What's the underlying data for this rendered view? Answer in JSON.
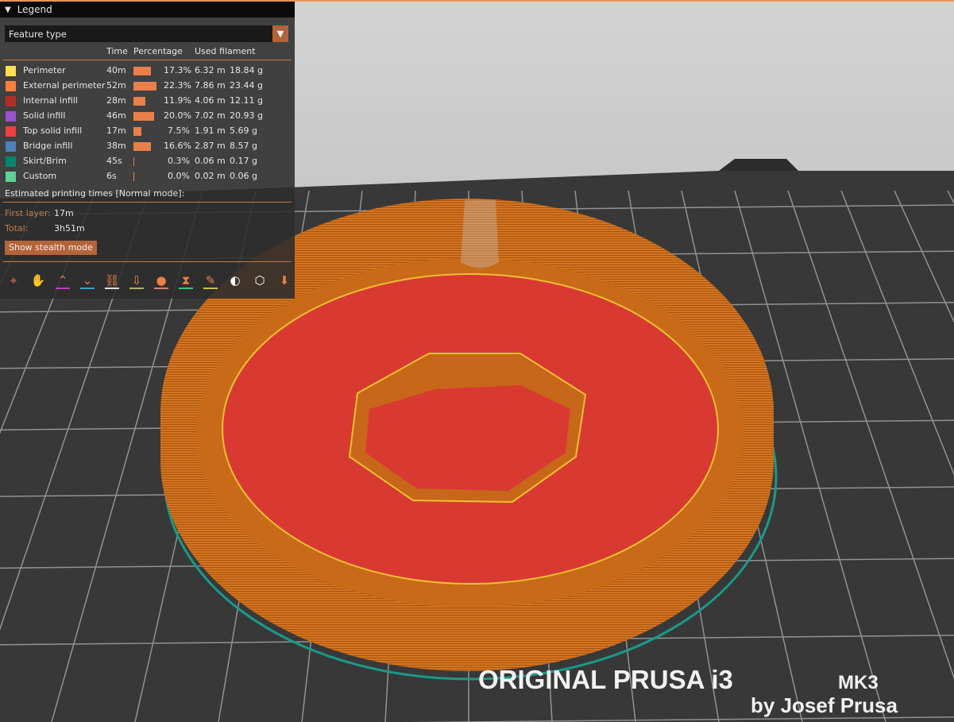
{
  "legend": {
    "title": "Legend",
    "view_type": "Feature type",
    "columns": {
      "time": "Time",
      "percentage": "Percentage",
      "used_filament": "Used filament"
    },
    "rows": [
      {
        "label": "Perimeter",
        "color": "#ffe14d",
        "time": "40m",
        "percent": 17.3,
        "percent_label": "17.3%",
        "length": "6.32 m",
        "weight": "18.84 g"
      },
      {
        "label": "External perimeter",
        "color": "#ff7d38",
        "time": "52m",
        "percent": 22.3,
        "percent_label": "22.3%",
        "length": "7.86 m",
        "weight": "23.44 g"
      },
      {
        "label": "Internal infill",
        "color": "#b03029",
        "time": "28m",
        "percent": 11.9,
        "percent_label": "11.9%",
        "length": "4.06 m",
        "weight": "12.11 g"
      },
      {
        "label": "Solid infill",
        "color": "#9654cc",
        "time": "46m",
        "percent": 20.0,
        "percent_label": "20.0%",
        "length": "7.02 m",
        "weight": "20.93 g"
      },
      {
        "label": "Top solid infill",
        "color": "#f04040",
        "time": "17m",
        "percent": 7.5,
        "percent_label": "7.5%",
        "length": "1.91 m",
        "weight": "5.69 g"
      },
      {
        "label": "Bridge infill",
        "color": "#4d80ba",
        "time": "38m",
        "percent": 16.6,
        "percent_label": "16.6%",
        "length": "2.87 m",
        "weight": "8.57 g"
      },
      {
        "label": "Skirt/Brim",
        "color": "#00876e",
        "time": "45s",
        "percent": 0.3,
        "percent_label": "0.3%",
        "length": "0.06 m",
        "weight": "0.17 g"
      },
      {
        "label": "Custom",
        "color": "#5ed194",
        "time": "6s",
        "percent": 0.0,
        "percent_label": "0.0%",
        "length": "0.02 m",
        "weight": "0.06 g"
      }
    ],
    "estimated_title": "Estimated printing times [Normal mode]:",
    "first_layer_label": "First layer:",
    "first_layer_value": "17m",
    "total_label": "Total:",
    "total_value": "3h51m",
    "stealth_button": "Show stealth mode",
    "toolbar_icons": [
      {
        "name": "travel-icon",
        "glyph": "⌖",
        "underline": ""
      },
      {
        "name": "wipe-icon",
        "glyph": "✋",
        "underline": ""
      },
      {
        "name": "retractions-icon",
        "glyph": "⌃",
        "underline": "#c040c0"
      },
      {
        "name": "deretractions-icon",
        "glyph": "⌄",
        "underline": "#3aa0c8"
      },
      {
        "name": "seams-icon",
        "glyph": "⛓",
        "underline": "#e0e0e0"
      },
      {
        "name": "tool-changes-icon",
        "glyph": "⇩",
        "underline": "#b0b060"
      },
      {
        "name": "color-changes-icon",
        "glyph": "●",
        "underline": "#d08080"
      },
      {
        "name": "pause-prints-icon",
        "glyph": "⧗",
        "underline": "#40c080"
      },
      {
        "name": "custom-gcodes-icon",
        "glyph": "✎",
        "underline": "#d0c040"
      },
      {
        "name": "center-of-gravity-icon",
        "glyph": "◐",
        "underline": ""
      },
      {
        "name": "shells-icon",
        "glyph": "⬡",
        "underline": ""
      },
      {
        "name": "tool-marker-icon",
        "glyph": "⬇",
        "underline": ""
      }
    ]
  },
  "bed": {
    "brand_line1": "ORIGINAL PRUSA i3",
    "brand_mk": "MK3",
    "brand_line2": "by Josef Prusa"
  }
}
